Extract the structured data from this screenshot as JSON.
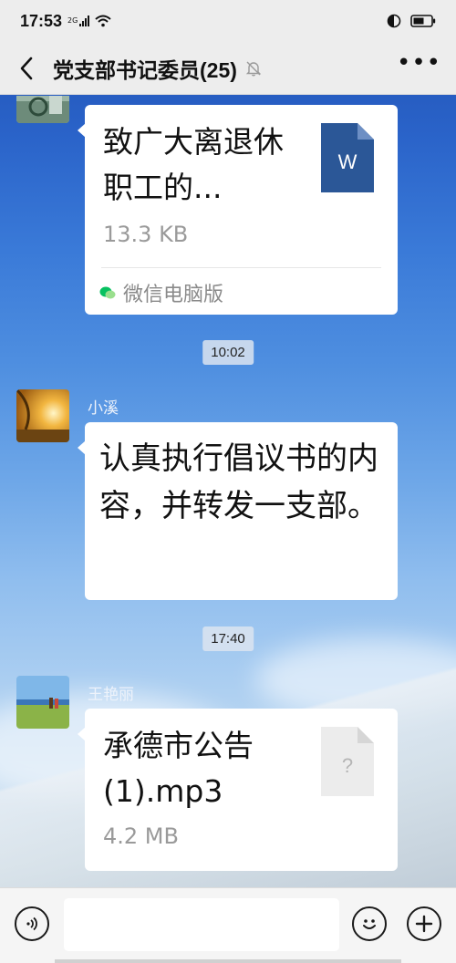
{
  "status": {
    "time": "17:53",
    "network": "2G"
  },
  "header": {
    "title": "党支部书记委员(25)"
  },
  "messages": [
    {
      "type": "file",
      "name": "致广大离退休职工的...",
      "size": "13.3 KB",
      "source": "微信电脑版",
      "file_badge": "W"
    },
    {
      "type": "time",
      "text": "10:02"
    },
    {
      "type": "text",
      "sender": "小溪",
      "text": "认真执行倡议书的内容，并转发一支部。"
    },
    {
      "type": "time",
      "text": "17:40"
    },
    {
      "type": "file",
      "sender": "王艳丽",
      "name": "承德市公告(1).mp3",
      "size": "4.2 MB",
      "file_badge": "?"
    }
  ],
  "colors": {
    "word_blue": "#2b5797",
    "header_bg": "#ededed",
    "wechat_green": "#07c160"
  },
  "icons": [
    "back-icon",
    "mute-icon",
    "more-icon",
    "word-file-icon",
    "wechat-pc-icon",
    "unknown-file-icon",
    "voice-icon",
    "emoji-icon",
    "add-icon"
  ]
}
